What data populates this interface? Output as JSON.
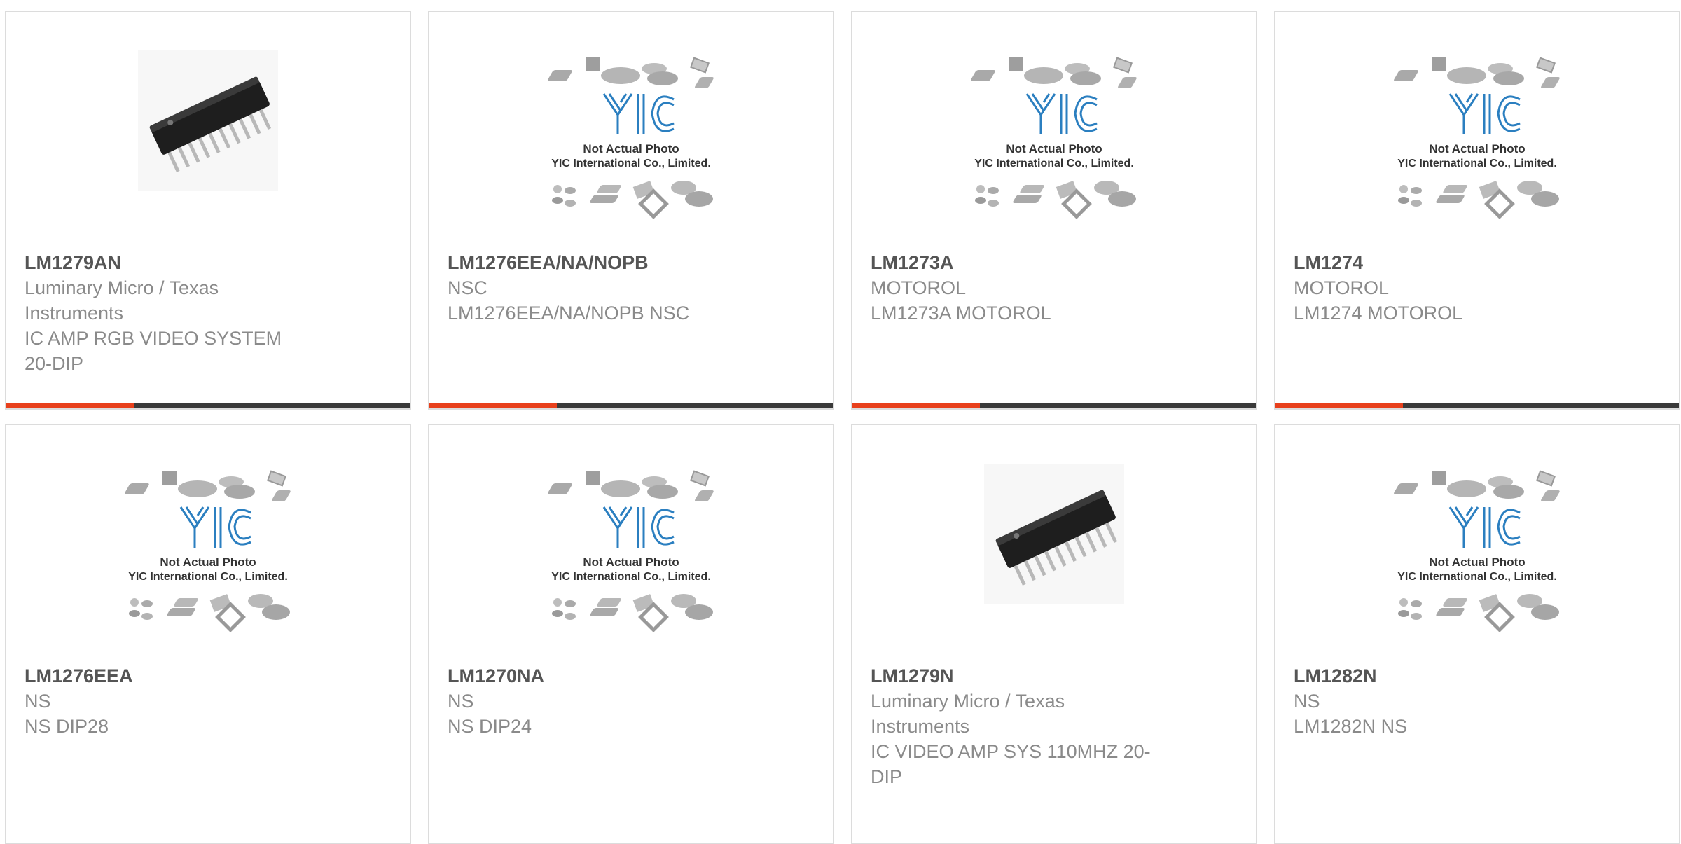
{
  "colors": {
    "accent": "#e8401c",
    "bar": "#3a3a3a",
    "logo": "#2b7fc0"
  },
  "placeholder": {
    "line1": "Not Actual Photo",
    "line2": "YIC International Co., Limited.",
    "logo": "YIC"
  },
  "products": [
    {
      "part": "LM1279AN",
      "lines": [
        "Luminary Micro / Texas",
        "Instruments",
        "IC AMP RGB VIDEO SYSTEM",
        "20-DIP"
      ],
      "image": "dip-chip"
    },
    {
      "part": "LM1276EEA/NA/NOPB",
      "lines": [
        "NSC",
        "LM1276EEA/NA/NOPB NSC"
      ],
      "image": "placeholder"
    },
    {
      "part": "LM1273A",
      "lines": [
        "MOTOROL",
        "LM1273A MOTOROL"
      ],
      "image": "placeholder"
    },
    {
      "part": "LM1274",
      "lines": [
        "MOTOROL",
        "LM1274 MOTOROL"
      ],
      "image": "placeholder"
    },
    {
      "part": "LM1276EEA",
      "lines": [
        "NS",
        "NS DIP28"
      ],
      "image": "placeholder"
    },
    {
      "part": "LM1270NA",
      "lines": [
        "NS",
        "NS DIP24"
      ],
      "image": "placeholder"
    },
    {
      "part": "LM1279N",
      "lines": [
        "Luminary Micro / Texas",
        "Instruments",
        "IC VIDEO AMP SYS 110MHZ 20-",
        "DIP"
      ],
      "image": "dip-chip"
    },
    {
      "part": "LM1282N",
      "lines": [
        "NS",
        "LM1282N NS"
      ],
      "image": "placeholder"
    }
  ]
}
